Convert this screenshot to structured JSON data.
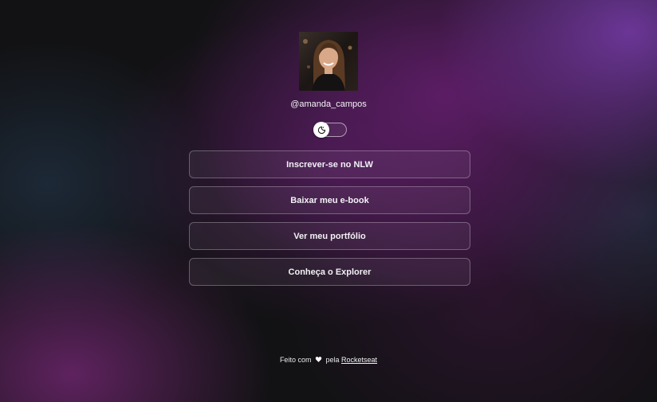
{
  "profile": {
    "username": "@amanda_campos",
    "avatar_alt": "avatar"
  },
  "theme_switch": {
    "icon": "moon-icon"
  },
  "links": [
    {
      "label": "Inscrever-se no NLW"
    },
    {
      "label": "Baixar meu e-book"
    },
    {
      "label": "Ver meu portfólio"
    },
    {
      "label": "Conheça o Explorer"
    }
  ],
  "footer": {
    "prefix": "Feito com",
    "heart_icon": "heart-icon",
    "middle": "pela",
    "link_label": "Rocketseat"
  },
  "colors": {
    "background": "#121214",
    "purple_glow": "#661e70",
    "button_border": "#ffffff47",
    "text": "#f1f1f4"
  }
}
